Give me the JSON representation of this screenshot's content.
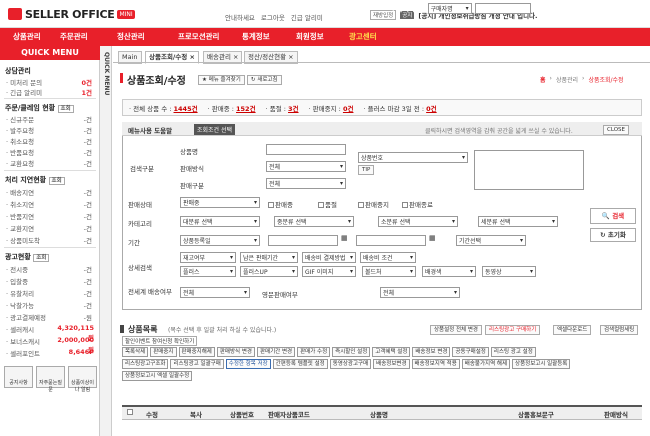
{
  "header": {
    "logo": "SELLER OFFICE",
    "mini": "MINI",
    "links": [
      "안내하세요",
      "로그아웃",
      "긴급 알리미"
    ],
    "notice_tag1": "재방입정",
    "notice_tag2": "공지",
    "notice_text": "[공지] 개인정보취급방침 개정 안내 입니다."
  },
  "nav": {
    "items": [
      "상품관리",
      "주문관리",
      "정산관리",
      "프로모션관리",
      "통계정보",
      "회원정보",
      "광고센터"
    ],
    "search_label": "주문자 검색",
    "search_select": "구매자명",
    "go": "GO"
  },
  "quick_menu": {
    "title": "QUICK MENU",
    "vertical_label": "QUICK MENU",
    "sections": [
      {
        "title": "상담관리",
        "items": [
          {
            "label": "· 미처리 문의",
            "value": "0건"
          },
          {
            "label": "· 긴급 알리미",
            "value": "1건"
          }
        ]
      },
      {
        "title": "주문/클레임 현황",
        "badge": "조회",
        "items": [
          {
            "label": "· 신규주문",
            "value": "-건"
          },
          {
            "label": "· 발주요청",
            "value": "-건"
          },
          {
            "label": "· 취소요청",
            "value": "-건"
          },
          {
            "label": "· 반품요청",
            "value": "-건"
          },
          {
            "label": "· 교환요청",
            "value": "-건"
          }
        ]
      },
      {
        "title": "처리 지연현황",
        "badge": "조회",
        "items": [
          {
            "label": "· 배송지연",
            "value": "-건"
          },
          {
            "label": "· 취소지연",
            "value": "-건"
          },
          {
            "label": "· 반품지연",
            "value": "-건"
          },
          {
            "label": "· 교환지연",
            "value": "-건"
          },
          {
            "label": "· 상품미도착",
            "value": "-건"
          }
        ]
      },
      {
        "title": "광고현황",
        "badge": "조회",
        "items": [
          {
            "label": "· 전시중",
            "value": "-건"
          },
          {
            "label": "· 입찰중",
            "value": "-건"
          },
          {
            "label": "· 유찰처리",
            "value": "-건"
          },
          {
            "label": "· 낙찰가능",
            "value": "-건"
          },
          {
            "label": "· 광고결제예정",
            "value": "-원"
          },
          {
            "label": "· 셀러캐시",
            "value": "4,320,115원"
          },
          {
            "label": "· 보너스캐시",
            "value": "2,000,000원"
          },
          {
            "label": "· 셀러포인트",
            "value": "8,646P"
          }
        ]
      }
    ],
    "bottom_buttons": [
      "공지사항",
      "자주묻는질문",
      "상품이상이나 알림"
    ]
  },
  "tabs": [
    {
      "label": "Main"
    },
    {
      "label": "상품조회/수정",
      "active": true
    },
    {
      "label": "배송관리"
    },
    {
      "label": "정산/정산현황"
    }
  ],
  "page": {
    "title": "상품조회/수정",
    "btn_favorite": "메뉴 즐겨찾기",
    "btn_refresh": "새로고침",
    "breadcrumb": [
      "홈",
      "상품관리",
      "상품조회/수정"
    ]
  },
  "stats": {
    "total_label": "전체 상품 수 :",
    "total": "1445건",
    "selling_label": "판매중 :",
    "selling": "152건",
    "soldout_label": "품절 :",
    "soldout": "3건",
    "stopped_label": "판매중지 :",
    "stopped": "0건",
    "plus_label": "플러스 마감 3일 전 :",
    "plus": "0건"
  },
  "search": {
    "help_badge": "메뉴사용 도움말",
    "help_select": "조회조건 선택",
    "hint": "클릭하시면 검색영역을 감춰 공간을 넓게 쓰실 수 있습니다.",
    "close": "CLOSE",
    "category_label": "검색구분",
    "fields": [
      "상품명",
      "판매방식",
      "판매구분"
    ],
    "product_no": "상품번호",
    "tip": "TIP",
    "all": "전체",
    "status_label": "판매상태",
    "status_opts": [
      "판매중",
      "판매중",
      "품절",
      "판매중지",
      "판매종료"
    ],
    "category2_label": "카테고리",
    "cats": [
      "대분류 선택",
      "중분류 선택",
      "소분류 선택",
      "세분류 선택"
    ],
    "period_label": "기간",
    "period_select": "상품등록일",
    "period_choice": "기간선택",
    "detail_label": "상세검색",
    "detail_row1": [
      "재고여부",
      "남은 판매기간",
      "배송비 결제방법",
      "배송비 조건"
    ],
    "detail_row2": [
      "플러스",
      "플러스UP",
      "GIF 이미지",
      "볼드처",
      "배경색",
      "동영상"
    ],
    "exposure_label": "전세계 배송여부",
    "english_label": "영문판매여부",
    "btn_search": "검색",
    "btn_reset": "초기화"
  },
  "list": {
    "title": "상품목록",
    "subtitle": "(복수 선택 후 일괄 처리 하실 수 있습니다.)",
    "btn_excel": "상품설정 전체 변경",
    "btn_listing": "리스팅광고 구매하기",
    "btn_download": "엑셀다운로드",
    "btn_columns": "검색컬럼세팅",
    "event_badge": "할인이벤트 참여신청 확인하기",
    "fn_row1": [
      "목록삭제",
      "판매중지",
      "판매중지해제",
      "판매방식 변경",
      "판매기간 변경",
      "판매가 수정",
      "즉시할인 설정",
      "고객혜택 설정",
      "배송정보 변경",
      "공동구매설정",
      "리스팅 광고 설정"
    ],
    "fn_row2": [
      "리스팅광고구조화",
      "리스팅광고 일괄구매",
      "수정한 항목 저장",
      "간편등록 템플릿 설정",
      "동영상광고구매",
      "배송정보변경",
      "배송정보지역 적용",
      "배송불가지역 해제",
      "상품정보고시 일괄등록"
    ],
    "fn_row3": [
      "상품정보고시 엑셀 일괄수정"
    ],
    "columns": [
      "수정",
      "복사",
      "상품번호",
      "판매자상품코드",
      "상품명",
      "상품홍보문구",
      "판매방식"
    ]
  }
}
